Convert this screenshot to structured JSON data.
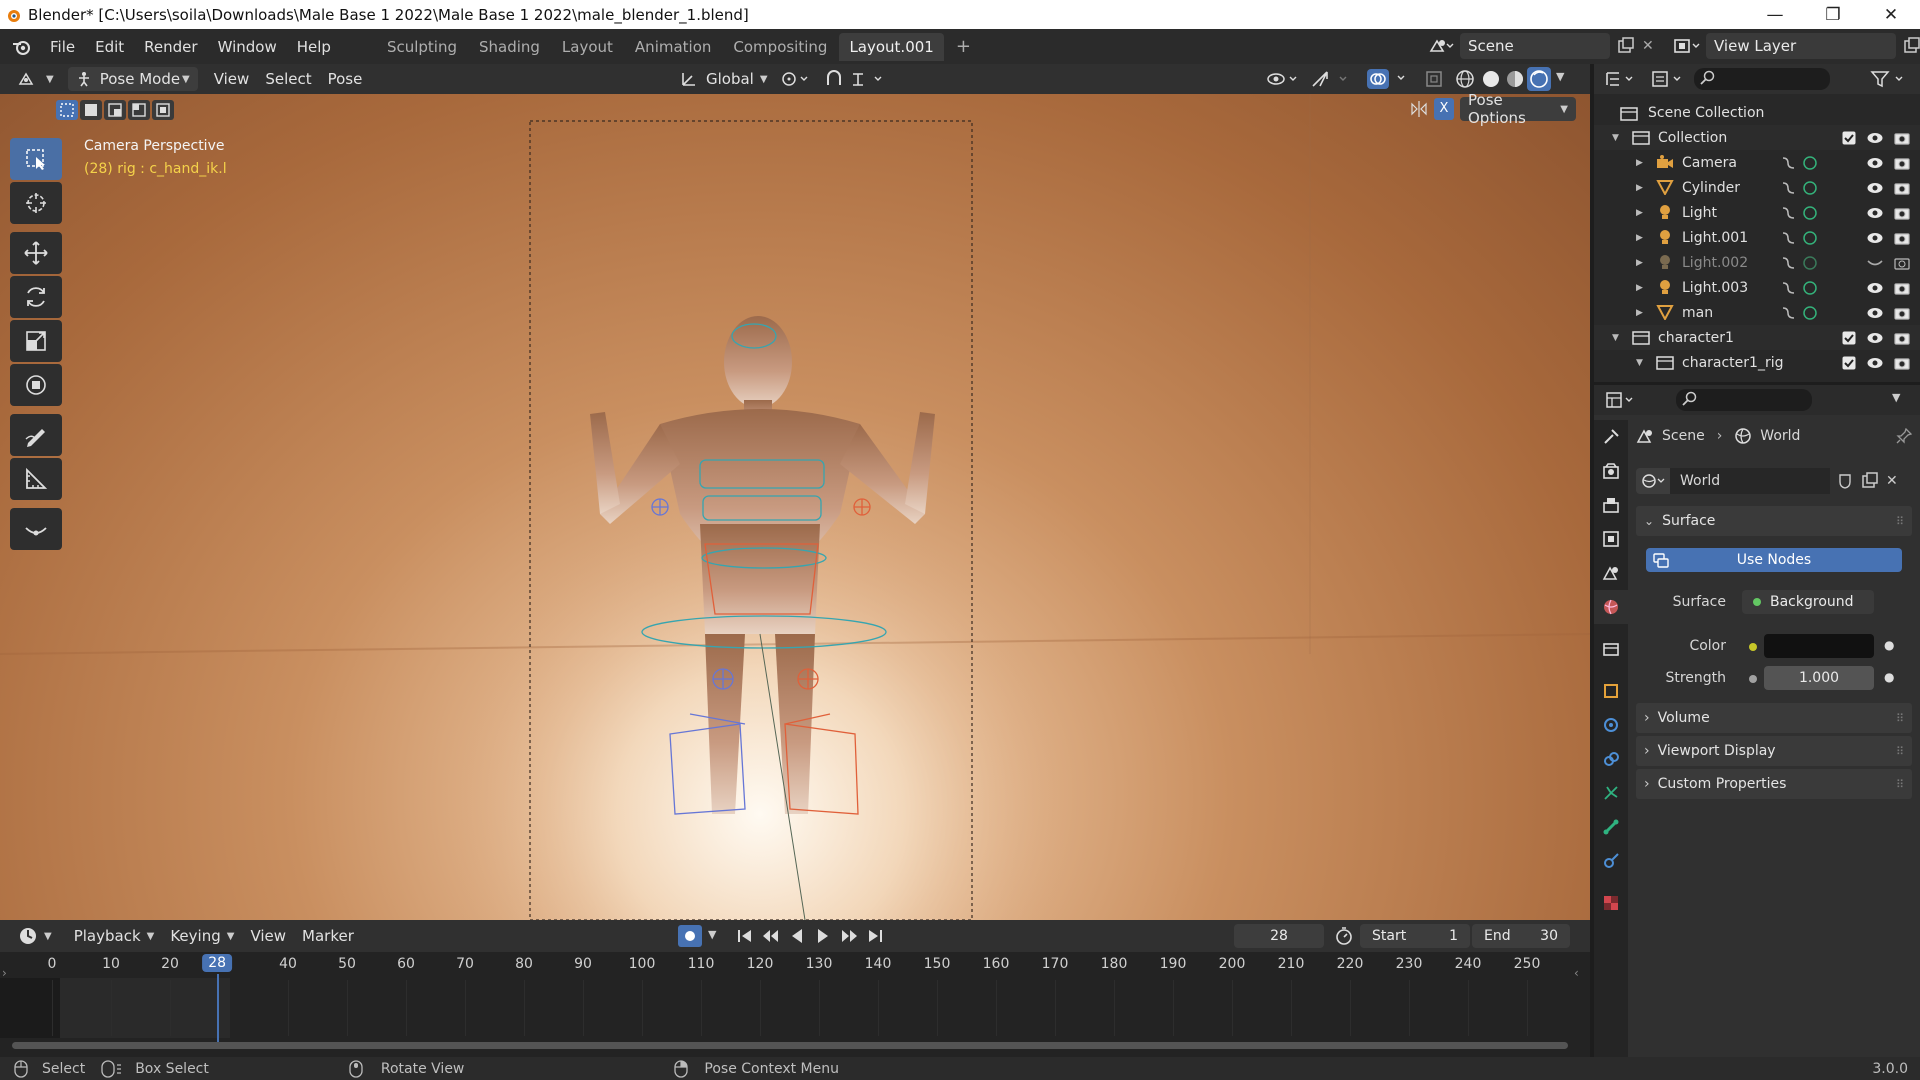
{
  "titlebar": {
    "title": "Blender* [C:\\Users\\soila\\Downloads\\Male Base 1 2022\\Male Base 1 2022\\male_blender_1.blend]",
    "minimize": "—",
    "maximize": "❐",
    "close": "✕"
  },
  "menu": {
    "file": "File",
    "edit": "Edit",
    "render": "Render",
    "window": "Window",
    "help": "Help"
  },
  "workspaces": [
    {
      "label": "Sculpting"
    },
    {
      "label": "Shading"
    },
    {
      "label": "Layout"
    },
    {
      "label": "Animation"
    },
    {
      "label": "Compositing"
    },
    {
      "label": "Layout.001"
    }
  ],
  "workspace_add": "+",
  "scene": {
    "name": "Scene",
    "view_layer": "View Layer"
  },
  "viewport_header": {
    "mode": "Pose Mode",
    "view": "View",
    "select": "Select",
    "pose": "Pose",
    "orientation": "Global",
    "pose_options": "Pose Options",
    "x_label": "X"
  },
  "viewport": {
    "camera_label": "Camera Perspective",
    "active_info": "(28) rig : c_hand_ik.l"
  },
  "outliner": {
    "title": "Scene Collection",
    "rows": [
      {
        "label": "Collection",
        "type": "collection"
      },
      {
        "label": "Camera",
        "type": "camera"
      },
      {
        "label": "Cylinder",
        "type": "mesh"
      },
      {
        "label": "Light",
        "type": "light"
      },
      {
        "label": "Light.001",
        "type": "light"
      },
      {
        "label": "Light.002",
        "type": "light",
        "hidden": true
      },
      {
        "label": "Light.003",
        "type": "light"
      },
      {
        "label": "man",
        "type": "mesh"
      },
      {
        "label": "character1",
        "type": "collection"
      },
      {
        "label": "character1_rig",
        "type": "collection"
      }
    ]
  },
  "properties": {
    "breadcrumb_scene": "Scene",
    "breadcrumb_world": "World",
    "world_name": "World",
    "surface_panel": "Surface",
    "use_nodes": "Use Nodes",
    "surface_label": "Surface",
    "surface_value": "Background",
    "color_label": "Color",
    "strength_label": "Strength",
    "strength_value": "1.000",
    "volume_panel": "Volume",
    "viewport_display_panel": "Viewport Display",
    "custom_properties_panel": "Custom Properties",
    "colors": {
      "use_nodes_bg": "#4772b3",
      "world_color": "#111111"
    }
  },
  "timeline": {
    "playback": "Playback",
    "keying": "Keying",
    "view": "View",
    "marker": "Marker",
    "current_frame": "28",
    "start_label": "Start",
    "start_value": "1",
    "end_label": "End",
    "end_value": "30",
    "ticks": [
      "0",
      "10",
      "20",
      "28",
      "40",
      "50",
      "60",
      "70",
      "80",
      "90",
      "100",
      "110",
      "120",
      "130",
      "140",
      "150",
      "160",
      "170",
      "180",
      "190",
      "200",
      "210",
      "220",
      "230",
      "240",
      "250"
    ]
  },
  "statusbar": {
    "select": "Select",
    "box_select": "Box Select",
    "rotate_view": "Rotate View",
    "context_menu": "Pose Context Menu",
    "version": "3.0.0"
  }
}
